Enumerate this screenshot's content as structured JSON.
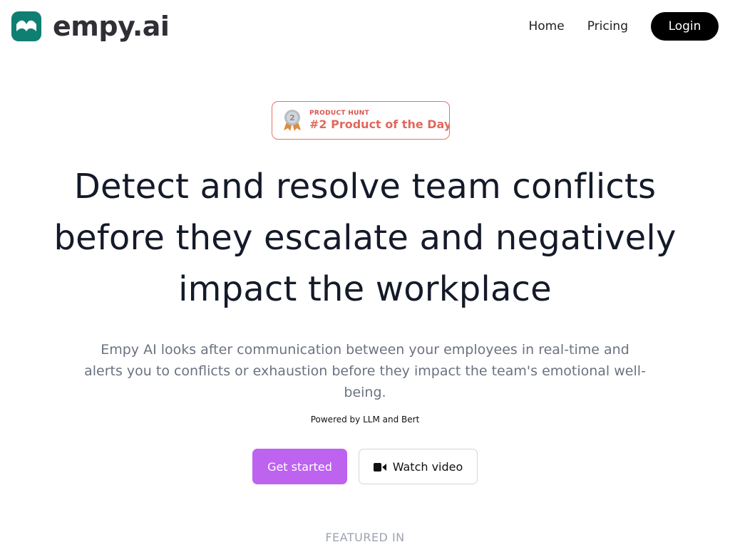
{
  "header": {
    "brand": "empy.ai",
    "nav": {
      "home": "Home",
      "pricing": "Pricing",
      "login": "Login"
    }
  },
  "badge": {
    "eyebrow": "PRODUCT HUNT",
    "title": "#2 Product of the Day",
    "rank": "2"
  },
  "hero": {
    "title_lines": [
      "Detect and resolve team conflicts",
      "before they escalate and negatively",
      "impact the workplace"
    ],
    "subtitle": "Empy AI looks after communication between your employees in real-time and alerts you to conflicts or exhaustion before they impact the team's emotional well-being.",
    "powered_by": "Powered by LLM and Bert"
  },
  "cta": {
    "primary": "Get started",
    "secondary": "Watch video"
  },
  "featured": {
    "label": "FEATURED IN"
  },
  "colors": {
    "brand_green": "#0f7f72",
    "accent_purple": "#bd63f0",
    "badge_red": "#e0695d",
    "login_black": "#000000"
  },
  "icons": {
    "logo": "open-book-icon",
    "badge": "medal-icon",
    "secondary_cta": "video-camera-icon"
  }
}
